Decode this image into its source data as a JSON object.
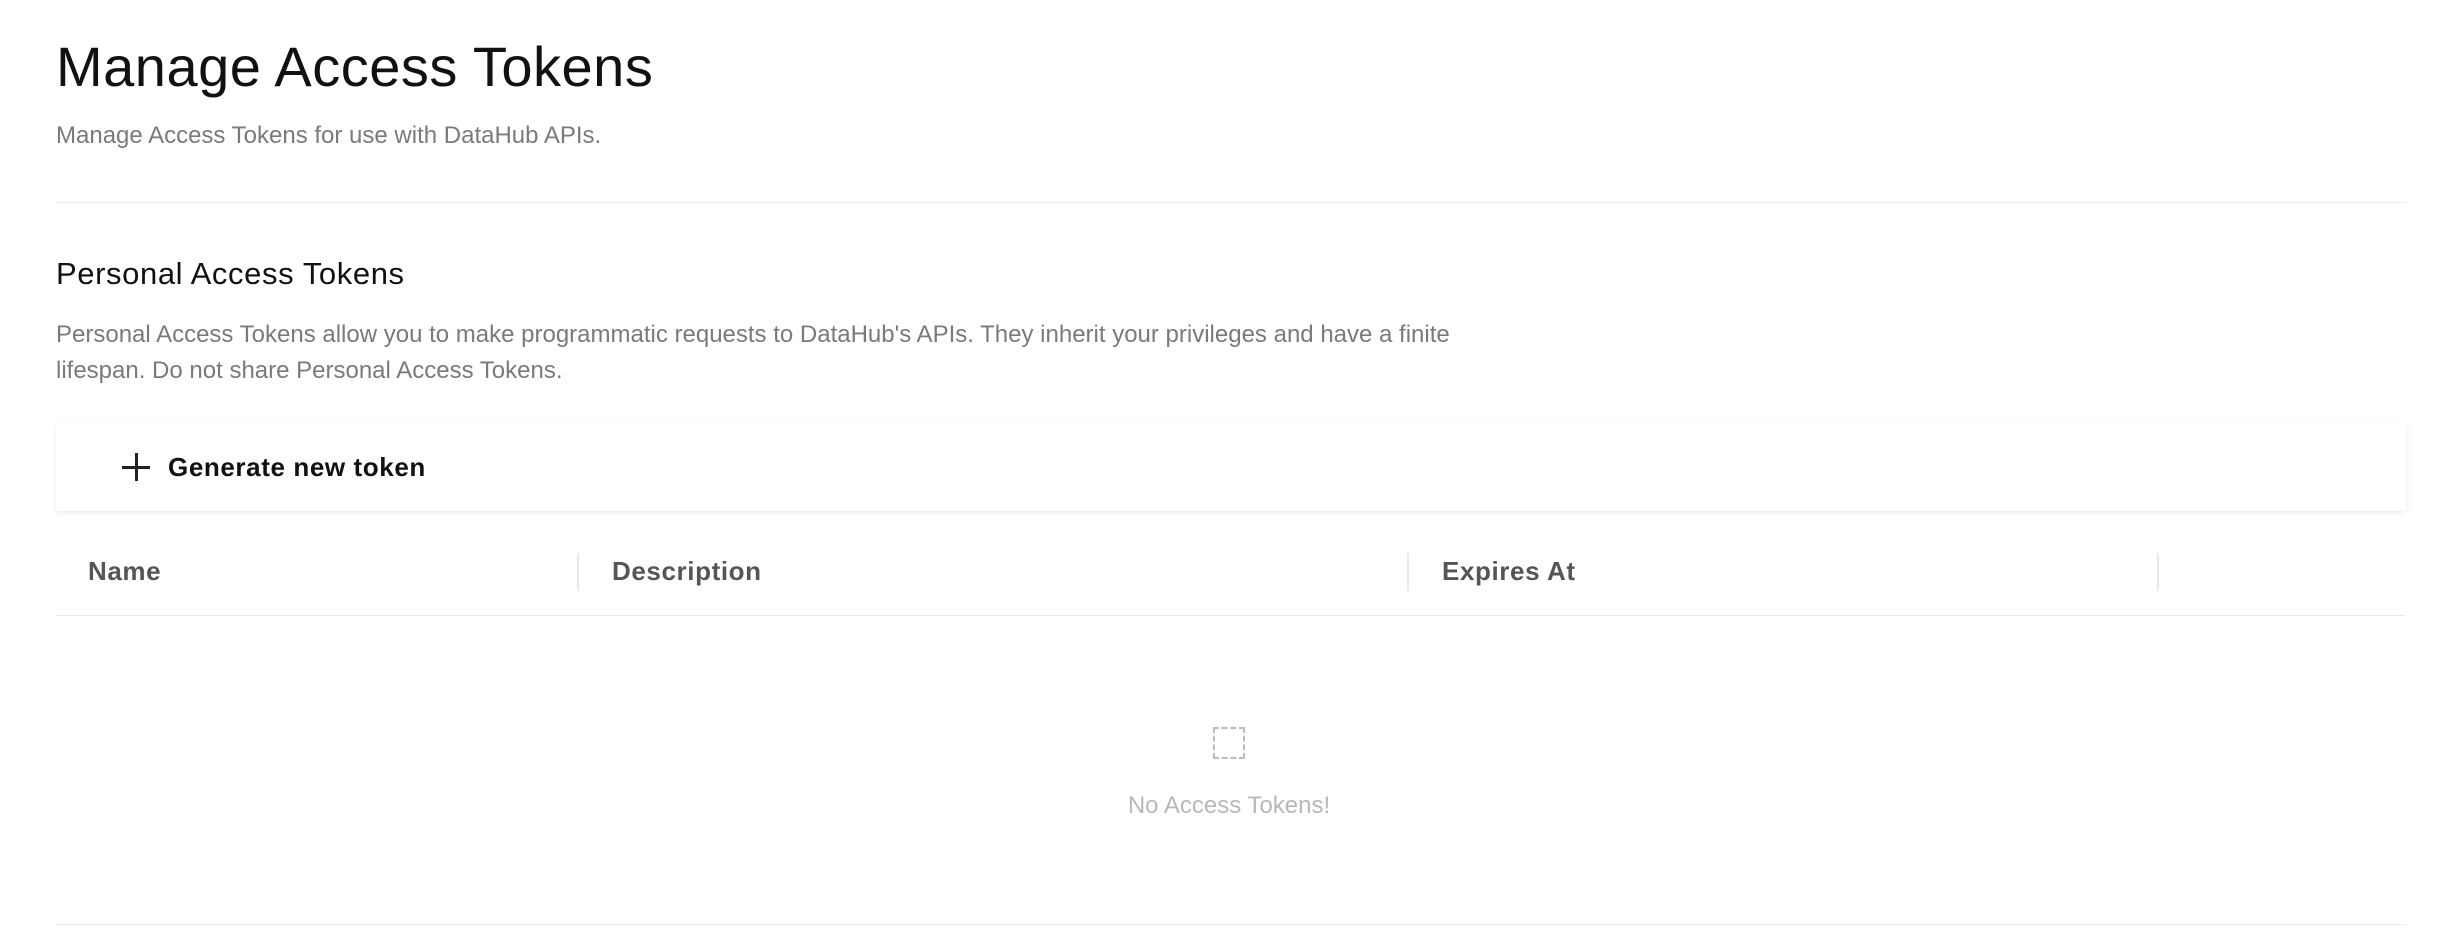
{
  "header": {
    "title": "Manage Access Tokens",
    "subtitle": "Manage Access Tokens for use with DataHub APIs."
  },
  "section": {
    "title": "Personal Access Tokens",
    "description": "Personal Access Tokens allow you to make programmatic requests to DataHub's APIs. They inherit your privileges and have a finite lifespan. Do not share Personal Access Tokens."
  },
  "toolbar": {
    "generate_label": "Generate new token",
    "generate_icon": "plus-icon"
  },
  "table": {
    "columns": [
      "Name",
      "Description",
      "Expires At",
      ""
    ],
    "rows": [],
    "empty_text": "No Access Tokens!",
    "empty_icon": "empty-box-icon"
  }
}
